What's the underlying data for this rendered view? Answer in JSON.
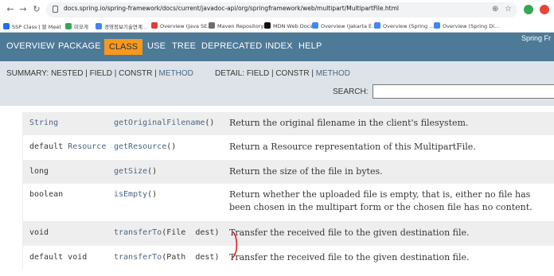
{
  "browser": {
    "url": "docs.spring.io/spring-framework/docs/current/javadoc-api/org/springframework/web/multipart/MultipartFile.html",
    "bookmarks": [
      {
        "label": "SSP Class | 블 Meet",
        "color": "#1a73e8"
      },
      {
        "label": "미모게",
        "color": "#34a853"
      },
      {
        "label": "경영정보기술연계...",
        "color": "#4285f4"
      },
      {
        "label": "Overview (Java SE...",
        "color": "#e53935"
      },
      {
        "label": "Maven Repository:...",
        "color": "#6d6d6d"
      },
      {
        "label": "MDN Web Docs",
        "color": "#111111"
      },
      {
        "label": "Overview (Jakarta E...",
        "color": "#4285f4"
      },
      {
        "label": "Overview (Spring ...",
        "color": "#4285f4"
      },
      {
        "label": "Overview (Spring Di...",
        "color": "#4285f4"
      }
    ]
  },
  "javadoc": {
    "brand": "Spring Fr",
    "nav": [
      "OVERVIEW",
      "PACKAGE",
      "CLASS",
      "USE",
      "TREE",
      "DEPRECATED",
      "INDEX",
      "HELP"
    ],
    "active_nav": "CLASS",
    "summary": {
      "prefix": "SUMMARY: NESTED | FIELD | CONSTR | ",
      "method": "METHOD"
    },
    "detail": {
      "prefix": "DETAIL: FIELD | CONSTR | ",
      "method": "METHOD"
    },
    "search_label": "SEARCH:",
    "search_value": ""
  },
  "methods": [
    {
      "modifier": "",
      "type": "String",
      "name": "getOriginalFilename",
      "params": "()",
      "description": "Return the original filename in the client's filesystem."
    },
    {
      "modifier": "default ",
      "type": "Resource",
      "name": "getResource",
      "params": "()",
      "description": "Return a Resource representation of this MultipartFile."
    },
    {
      "modifier": "",
      "type": "long",
      "name": "getSize",
      "params": "()",
      "description": "Return the size of the file in bytes."
    },
    {
      "modifier": "",
      "type": "boolean",
      "name": "isEmpty",
      "params": "()",
      "description": "Return whether the uploaded file is empty, that is, either no file has been chosen in the multipart form or the chosen file has no content."
    },
    {
      "modifier": "",
      "type": "void",
      "name": "transferTo",
      "params": "(File  dest)",
      "description": "Transfer the received file to the given destination file."
    },
    {
      "modifier": "default ",
      "type": "void",
      "name": "transferTo",
      "params": "(Path  dest)",
      "description": "Transfer the received file to the given destination file."
    }
  ],
  "colors": {
    "nav_bg": "#4d7a97",
    "active_tab": "#f8981d",
    "subnav_bg": "#dee3e9",
    "link": "#4a6782",
    "row_alt": "#eeeeef",
    "annotation": "#e02020"
  }
}
